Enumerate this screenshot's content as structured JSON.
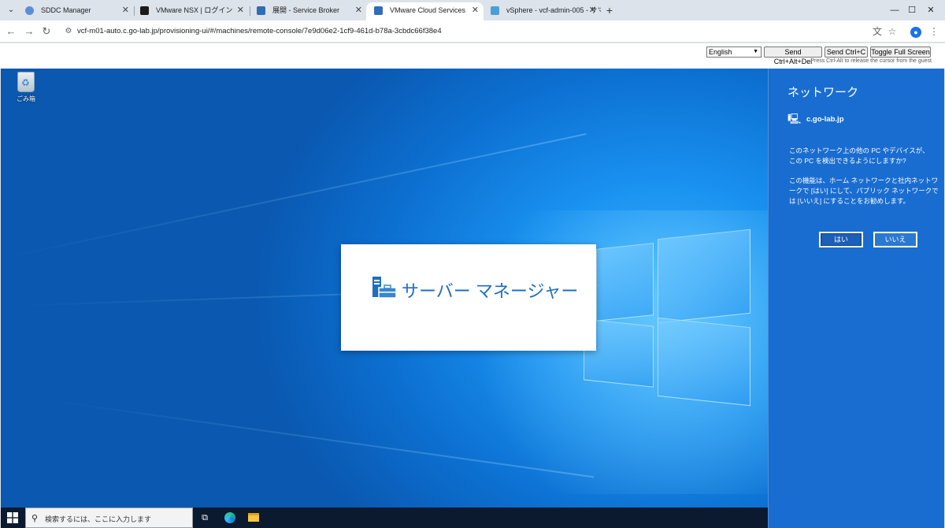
{
  "browser": {
    "tabs": [
      {
        "label": "SDDC Manager",
        "fav_color": "#5b8ed6",
        "active": false
      },
      {
        "label": "VMware NSX | ログイン",
        "fav_color": "#1b1b1b",
        "active": false
      },
      {
        "label": "展開 - Service Broker",
        "fav_color": "#2f6db5",
        "active": false
      },
      {
        "label": "VMware Cloud Services",
        "fav_color": "#2f6db5",
        "active": true
      },
      {
        "label": "vSphere - vcf-admin-005 - サマ",
        "fav_color": "#4aa0d6",
        "active": false
      }
    ],
    "url": "vcf-m01-auto.c.go-lab.jp/provisioning-ui/#/machines/remote-console/7e9d06e2-1cf9-461d-b78a-3cbdc66f38e4"
  },
  "console": {
    "language": "English",
    "send_cad_label": "Send Ctrl+Alt+Del",
    "send_ctrlc_label": "Send Ctrl+C",
    "fullscreen_label": "Toggle Full Screen",
    "hint": "Press Ctrl-Alt to release the cursor from the guest"
  },
  "desktop": {
    "recycle_bin_label": "ごみ箱",
    "splash_title": "サーバー マネージャー"
  },
  "network_flyout": {
    "title": "ネットワーク",
    "network_name": "c.go-lab.jp",
    "question": "このネットワーク上の他の PC やデバイスが、この PC を検出できるようにしますか?",
    "description": "この機能は、ホーム ネットワークと社内ネットワークで [はい] にして、パブリック ネットワークでは [いいえ] にすることをお勧めします。",
    "yes_label": "はい",
    "no_label": "いいえ"
  },
  "taskbar": {
    "search_placeholder": "検索するには、ここに入力します"
  },
  "colors": {
    "desktop_blue": "#0c6fd0",
    "flyout_blue": "#1a6dd0",
    "taskbar": "#0b1a2e",
    "accent": "#1f6ec0"
  }
}
